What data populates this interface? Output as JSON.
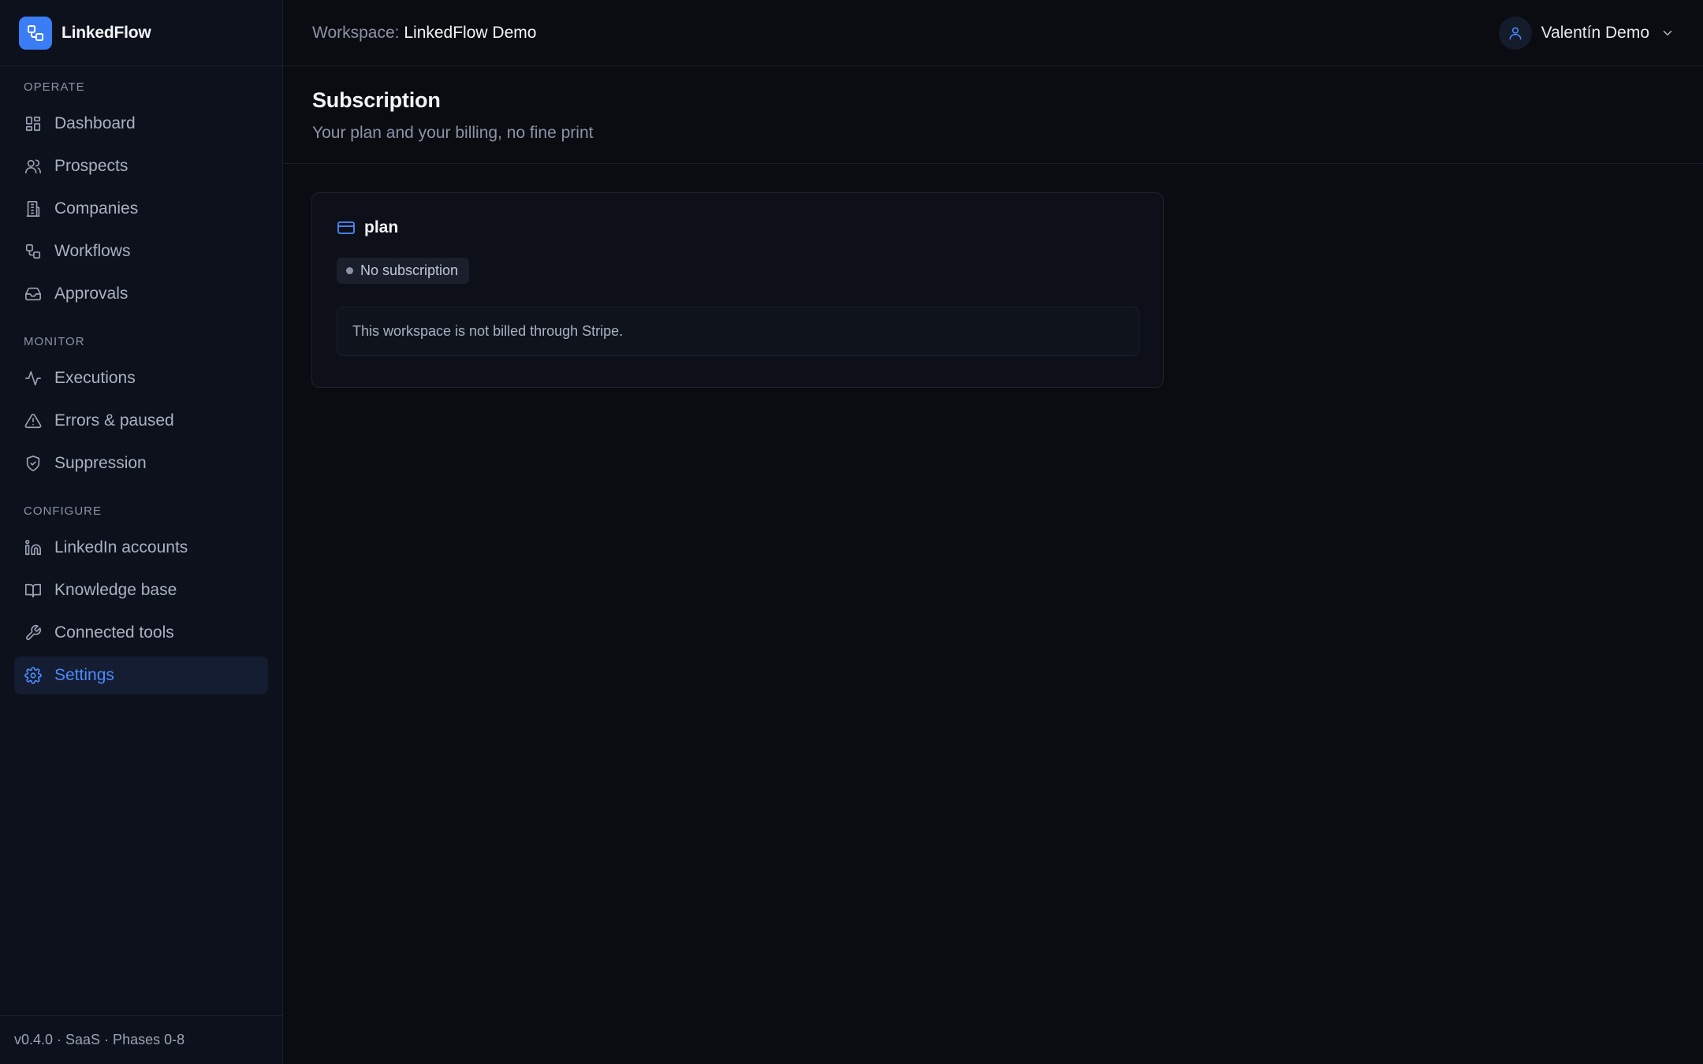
{
  "brand": {
    "name": "LinkedFlow",
    "logo_icon": "workflow-icon",
    "accent": "#3b7df5"
  },
  "sidebar": {
    "sections": [
      {
        "label": "OPERATE",
        "items": [
          {
            "label": "Dashboard",
            "icon": "dashboard-icon"
          },
          {
            "label": "Prospects",
            "icon": "users-icon"
          },
          {
            "label": "Companies",
            "icon": "building-icon"
          },
          {
            "label": "Workflows",
            "icon": "workflow-icon"
          },
          {
            "label": "Approvals",
            "icon": "inbox-icon"
          }
        ]
      },
      {
        "label": "MONITOR",
        "items": [
          {
            "label": "Executions",
            "icon": "activity-icon"
          },
          {
            "label": "Errors & paused",
            "icon": "warning-icon"
          },
          {
            "label": "Suppression",
            "icon": "shield-icon"
          }
        ]
      },
      {
        "label": "CONFIGURE",
        "items": [
          {
            "label": "LinkedIn accounts",
            "icon": "linkedin-icon"
          },
          {
            "label": "Knowledge base",
            "icon": "book-icon"
          },
          {
            "label": "Connected tools",
            "icon": "wrench-icon"
          },
          {
            "label": "Settings",
            "icon": "gear-icon",
            "active": true
          }
        ]
      }
    ],
    "footer": "v0.4.0 · SaaS · Phases 0-8"
  },
  "topbar": {
    "workspace_label": "Workspace:",
    "workspace_name": "LinkedFlow Demo",
    "user_name": "Valentín Demo",
    "user_icon": "user-icon",
    "menu_icon": "chevron-down-icon"
  },
  "page": {
    "title": "Subscription",
    "subtitle": "Your plan and your billing, no fine print"
  },
  "plan_card": {
    "title": "plan",
    "icon": "credit-card-icon",
    "status_badge": "No subscription",
    "notice": "This workspace is not billed through Stripe."
  },
  "colors": {
    "background": "#0a0c11",
    "sidebar": "#0d111b",
    "active_item_bg": "#141d31",
    "active_item_text": "#4d8bff"
  }
}
